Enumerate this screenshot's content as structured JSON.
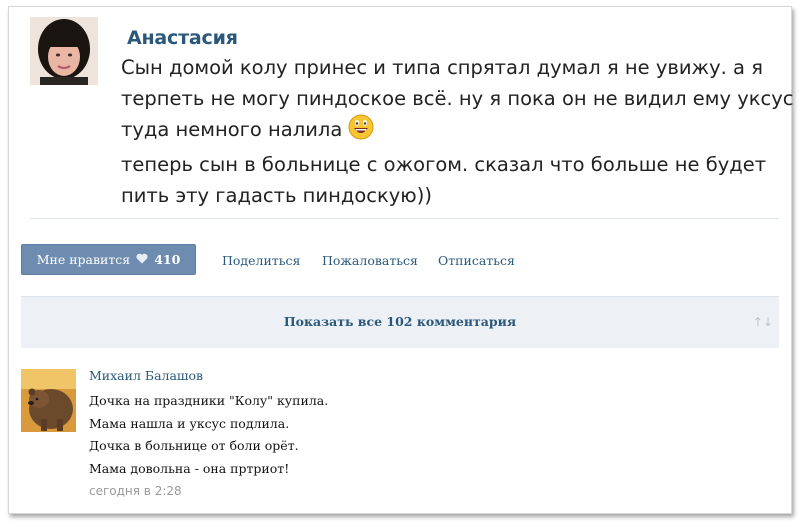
{
  "post": {
    "author": "Анастасия",
    "avatar_icon": "user-avatar-photo",
    "lines": [
      "Сын домой колу принес и типа спрятал думал я не увижу. а я",
      "терпеть не могу пиндоское всё. ну я пока он не видил ему уксус",
      "туда немного налила",
      "теперь сын в больнице с ожогом. сказал что больше не будет",
      "пить эту гадасть пиндоскую))"
    ],
    "emoji_icon": "laughing-smiley-icon"
  },
  "actions": {
    "like_label": "Мне нравится",
    "like_count": "410",
    "share": "Поделиться",
    "report": "Пожаловаться",
    "unsubscribe": "Отписаться"
  },
  "comments_bar": {
    "label": "Показать все 102 комментария"
  },
  "comment": {
    "author": "Михаил Балашов",
    "avatar_icon": "bear-avatar-image",
    "lines": [
      "Дочка на праздники \"Колу\" купила.",
      "Мама нашла и уксус подлила.",
      "Дочка в больнице от боли орёт.",
      "Мама довольна - она пртриот!"
    ],
    "time": "сегодня в 2:28"
  },
  "colors": {
    "link": "#2b587a",
    "like_button_bg": "#6d8cb0",
    "comments_bar_bg": "#edf1f5"
  }
}
